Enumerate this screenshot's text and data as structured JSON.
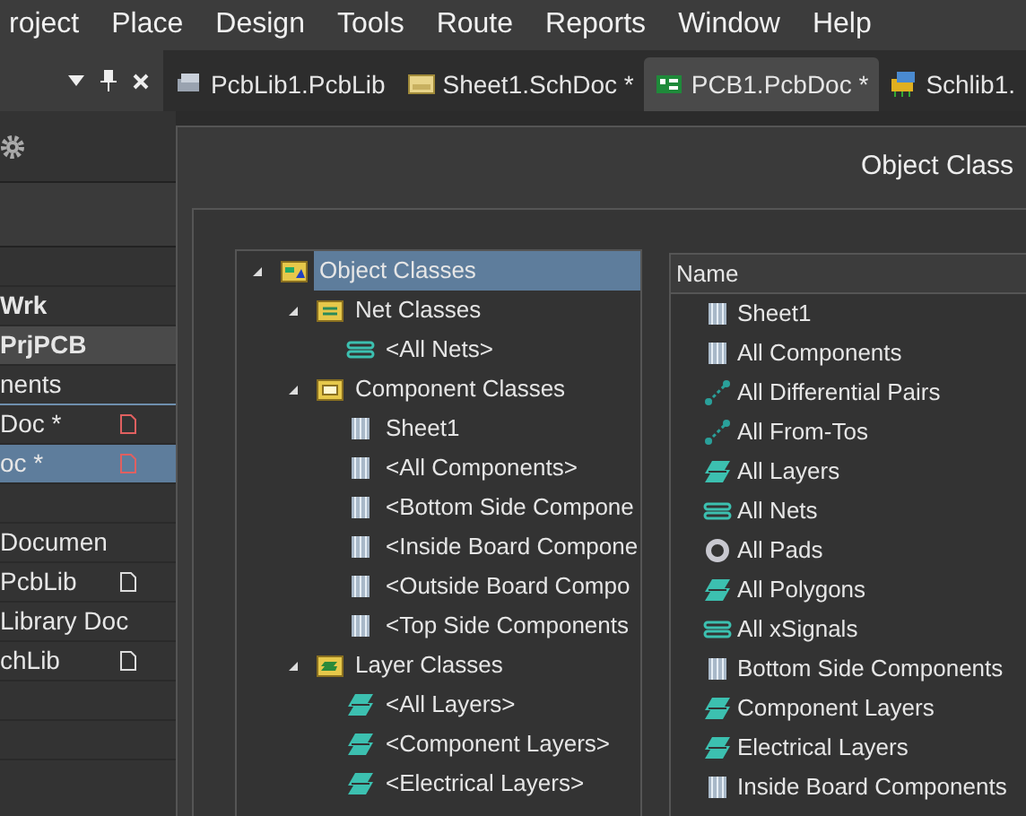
{
  "menu": [
    {
      "label": "roject"
    },
    {
      "label": "Place"
    },
    {
      "label": "Design"
    },
    {
      "label": "Tools"
    },
    {
      "label": "Route"
    },
    {
      "label": "Reports"
    },
    {
      "label": "Window"
    },
    {
      "label": "Help"
    }
  ],
  "tabs": [
    {
      "label": "PcbLib1.PcbLib",
      "kind": "pcblib",
      "selected": false
    },
    {
      "label": "Sheet1.SchDoc *",
      "kind": "sheet",
      "selected": false
    },
    {
      "label": "PCB1.PcbDoc *",
      "kind": "pcb",
      "selected": true
    },
    {
      "label": "Schlib1.",
      "kind": "schlib",
      "selected": false
    }
  ],
  "panel": {
    "rows": [
      {
        "label": "",
        "kind": "row",
        "selected": false
      },
      {
        "label": "Wrk",
        "kind": "row",
        "bold": true,
        "selected": false
      },
      {
        "label": "PrjPCB",
        "kind": "project",
        "bold": true,
        "selected": false
      },
      {
        "label": "nents",
        "kind": "group",
        "bold": false,
        "selected": false
      },
      {
        "label": "Doc *",
        "kind": "modified",
        "bold": false,
        "selected": false
      },
      {
        "label": "oc *",
        "kind": "modified",
        "bold": false,
        "selected": true
      },
      {
        "label": "",
        "kind": "row",
        "selected": false
      },
      {
        "label": "Documen",
        "kind": "row",
        "bold": false,
        "selected": false
      },
      {
        "label": "PcbLib",
        "kind": "saved",
        "bold": false,
        "selected": false
      },
      {
        "label": "Library Doc",
        "kind": "row",
        "bold": false,
        "selected": false
      },
      {
        "label": "chLib",
        "kind": "saved",
        "bold": false,
        "selected": false
      },
      {
        "label": "",
        "kind": "row",
        "selected": false
      },
      {
        "label": "",
        "kind": "row",
        "selected": false
      }
    ]
  },
  "dialog": {
    "title": "Object Class",
    "tree": [
      {
        "label": "Object Classes",
        "kind": "root",
        "expanded": true,
        "selected": true,
        "children": [
          {
            "label": "Net Classes",
            "kind": "netfolder",
            "expanded": true,
            "selected": false,
            "children": [
              {
                "label": "<All Nets>",
                "kind": "net",
                "selected": false
              }
            ]
          },
          {
            "label": "Component Classes",
            "kind": "compfolder",
            "expanded": true,
            "selected": false,
            "children": [
              {
                "label": "Sheet1",
                "kind": "chip",
                "selected": false
              },
              {
                "label": "<All Components>",
                "kind": "chip",
                "selected": false
              },
              {
                "label": "<Bottom Side Compone",
                "kind": "chip",
                "selected": false
              },
              {
                "label": "<Inside Board Compone",
                "kind": "chip",
                "selected": false
              },
              {
                "label": "<Outside Board Compo",
                "kind": "chip",
                "selected": false
              },
              {
                "label": "<Top Side Components",
                "kind": "chip",
                "selected": false
              }
            ]
          },
          {
            "label": "Layer Classes",
            "kind": "layerfolder",
            "expanded": true,
            "selected": false,
            "children": [
              {
                "label": "<All Layers>",
                "kind": "layer",
                "selected": false
              },
              {
                "label": "<Component Layers>",
                "kind": "layer",
                "selected": false
              },
              {
                "label": "<Electrical Layers>",
                "kind": "layer",
                "selected": false
              }
            ]
          }
        ]
      }
    ],
    "list": {
      "header": "Name",
      "items": [
        {
          "label": "Sheet1",
          "kind": "chip"
        },
        {
          "label": "All Components",
          "kind": "chip"
        },
        {
          "label": "All Differential Pairs",
          "kind": "pair"
        },
        {
          "label": "All From-Tos",
          "kind": "pair"
        },
        {
          "label": "All Layers",
          "kind": "layer"
        },
        {
          "label": "All Nets",
          "kind": "net"
        },
        {
          "label": "All Pads",
          "kind": "pad"
        },
        {
          "label": "All Polygons",
          "kind": "layer"
        },
        {
          "label": "All xSignals",
          "kind": "net"
        },
        {
          "label": "Bottom Side Components",
          "kind": "chip"
        },
        {
          "label": "Component Layers",
          "kind": "layer"
        },
        {
          "label": "Electrical Layers",
          "kind": "layer"
        },
        {
          "label": "Inside Board Components",
          "kind": "chip"
        }
      ]
    }
  }
}
